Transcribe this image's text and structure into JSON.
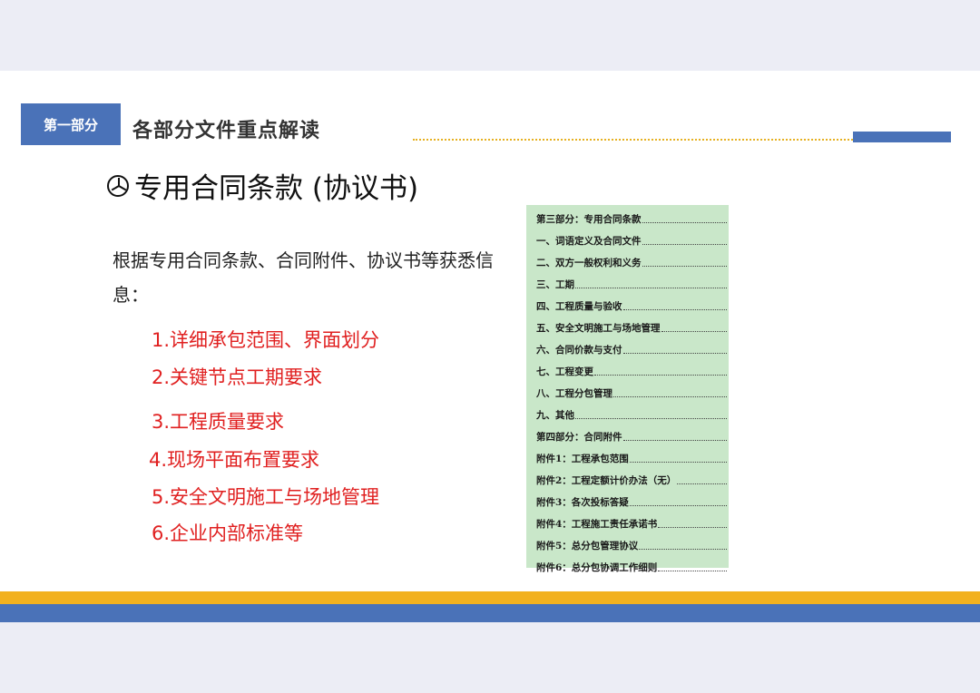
{
  "header": {
    "section_label": "第一部分",
    "section_title": "各部分文件重点解读"
  },
  "subtitle": "专用合同条款 (协议书)",
  "intro_text": "根据专用合同条款、合同附件、协议书等获悉信息：",
  "requirements": [
    "1.详细承包范围、界面划分",
    "2.关键节点工期要求",
    "3.工程质量要求",
    "4.现场平面布置要求",
    "5.安全文明施工与场地管理",
    "6.企业内部标准等"
  ],
  "toc": [
    "第三部分：专用合同条款",
    "一、词语定义及合同文件",
    "二、双方一般权利和义务",
    "三、工期",
    "四、工程质量与验收",
    "五、安全文明施工与场地管理",
    "六、合同价款与支付",
    "七、工程变更",
    "八、工程分包管理",
    "九、其他",
    "第四部分：合同附件",
    "附件1：工程承包范围",
    "附件2：工程定额计价办法（无）",
    "附件3：各次投标答疑",
    "附件4：工程施工责任承诺书",
    "附件5：总分包管理协议",
    "附件6：总分包协调工作细则"
  ],
  "colors": {
    "accent_blue": "#4a72b8",
    "accent_yellow": "#f2b11f",
    "requirement_red": "#e02020",
    "toc_green": "#c9e7c9"
  }
}
